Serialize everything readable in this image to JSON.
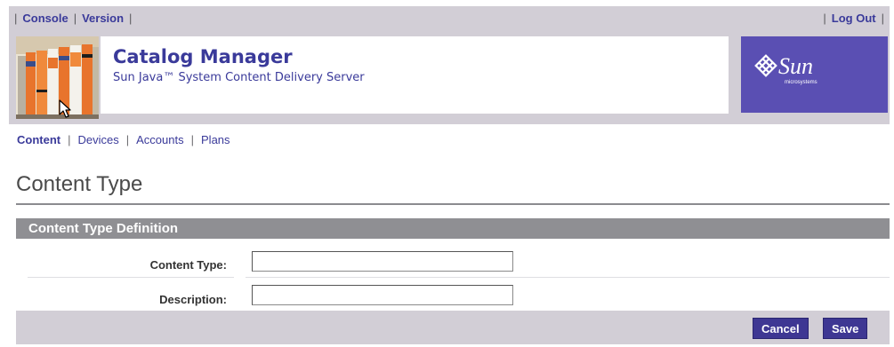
{
  "header": {
    "links_left": [
      "Console",
      "Version"
    ],
    "link_right": "Log Out",
    "app_title": "Catalog Manager",
    "app_subtitle": "Sun Java™ System Content Delivery Server",
    "logo_text": "Sun",
    "logo_sub": "microsystems"
  },
  "nav": {
    "items": [
      "Content",
      "Devices",
      "Accounts",
      "Plans"
    ],
    "active": "Content"
  },
  "page": {
    "title": "Content Type"
  },
  "section": {
    "title": "Content Type Definition",
    "fields": [
      {
        "label": "Content Type:",
        "value": "",
        "placeholder": ""
      },
      {
        "label": "Description:",
        "value": "",
        "placeholder": ""
      }
    ]
  },
  "actions": {
    "cancel": "Cancel",
    "save": "Save"
  },
  "colors": {
    "accent": "#3e3793",
    "link": "#3a3a9a",
    "masthead": "#d2ced6",
    "section_header": "#8f8f93",
    "logo_bg": "#5a4fb3"
  }
}
